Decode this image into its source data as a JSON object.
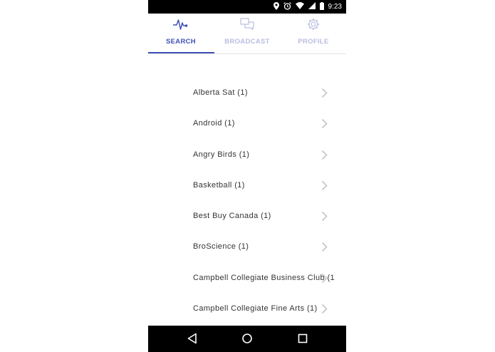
{
  "statusbar": {
    "time": "9:23"
  },
  "tabs": [
    {
      "label": "SEARCH",
      "icon": "pulse-icon",
      "active": true
    },
    {
      "label": "BROADCAST",
      "icon": "chat-icon",
      "active": false
    },
    {
      "label": "PROFILE",
      "icon": "gear-icon",
      "active": false
    }
  ],
  "colors": {
    "accent": "#3f51b5",
    "inactive": "#b8bde0",
    "text": "#333333",
    "chevron": "#c4c4c4"
  },
  "list": {
    "items": [
      "Alberta Sat (1)",
      "Android (1)",
      "Angry Birds (1)",
      "Basketball (1)",
      "Best Buy Canada (1)",
      "BroScience (1)",
      "Campbell Collegiate Business Club (1",
      "Campbell Collegiate Fine Arts (1)"
    ]
  },
  "navbar": {
    "back": "back-icon",
    "home": "home-icon",
    "recents": "recents-icon"
  }
}
